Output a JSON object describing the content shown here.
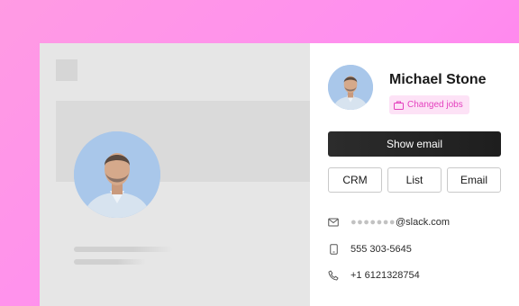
{
  "contact": {
    "name": "Michael Stone",
    "badge_label": "Changed jobs",
    "show_email_label": "Show email",
    "actions": [
      "CRM",
      "List",
      "Email"
    ],
    "email_mask": "●●●●●●●",
    "email_domain": "@slack.com",
    "mobile": "555 303-5645",
    "phone": "+1 6121328754"
  },
  "colors": {
    "background_gradient": [
      "#ff9be3",
      "#ff7fe6"
    ],
    "badge_bg": "#fde2f6",
    "badge_text": "#e43fbe",
    "primary_button": "#222222",
    "avatar_bg": "#a9c7ea"
  },
  "icons": {
    "badge": "briefcase-icon",
    "email": "mail-icon",
    "mobile": "mobile-phone-icon",
    "phone": "phone-handset-icon"
  }
}
